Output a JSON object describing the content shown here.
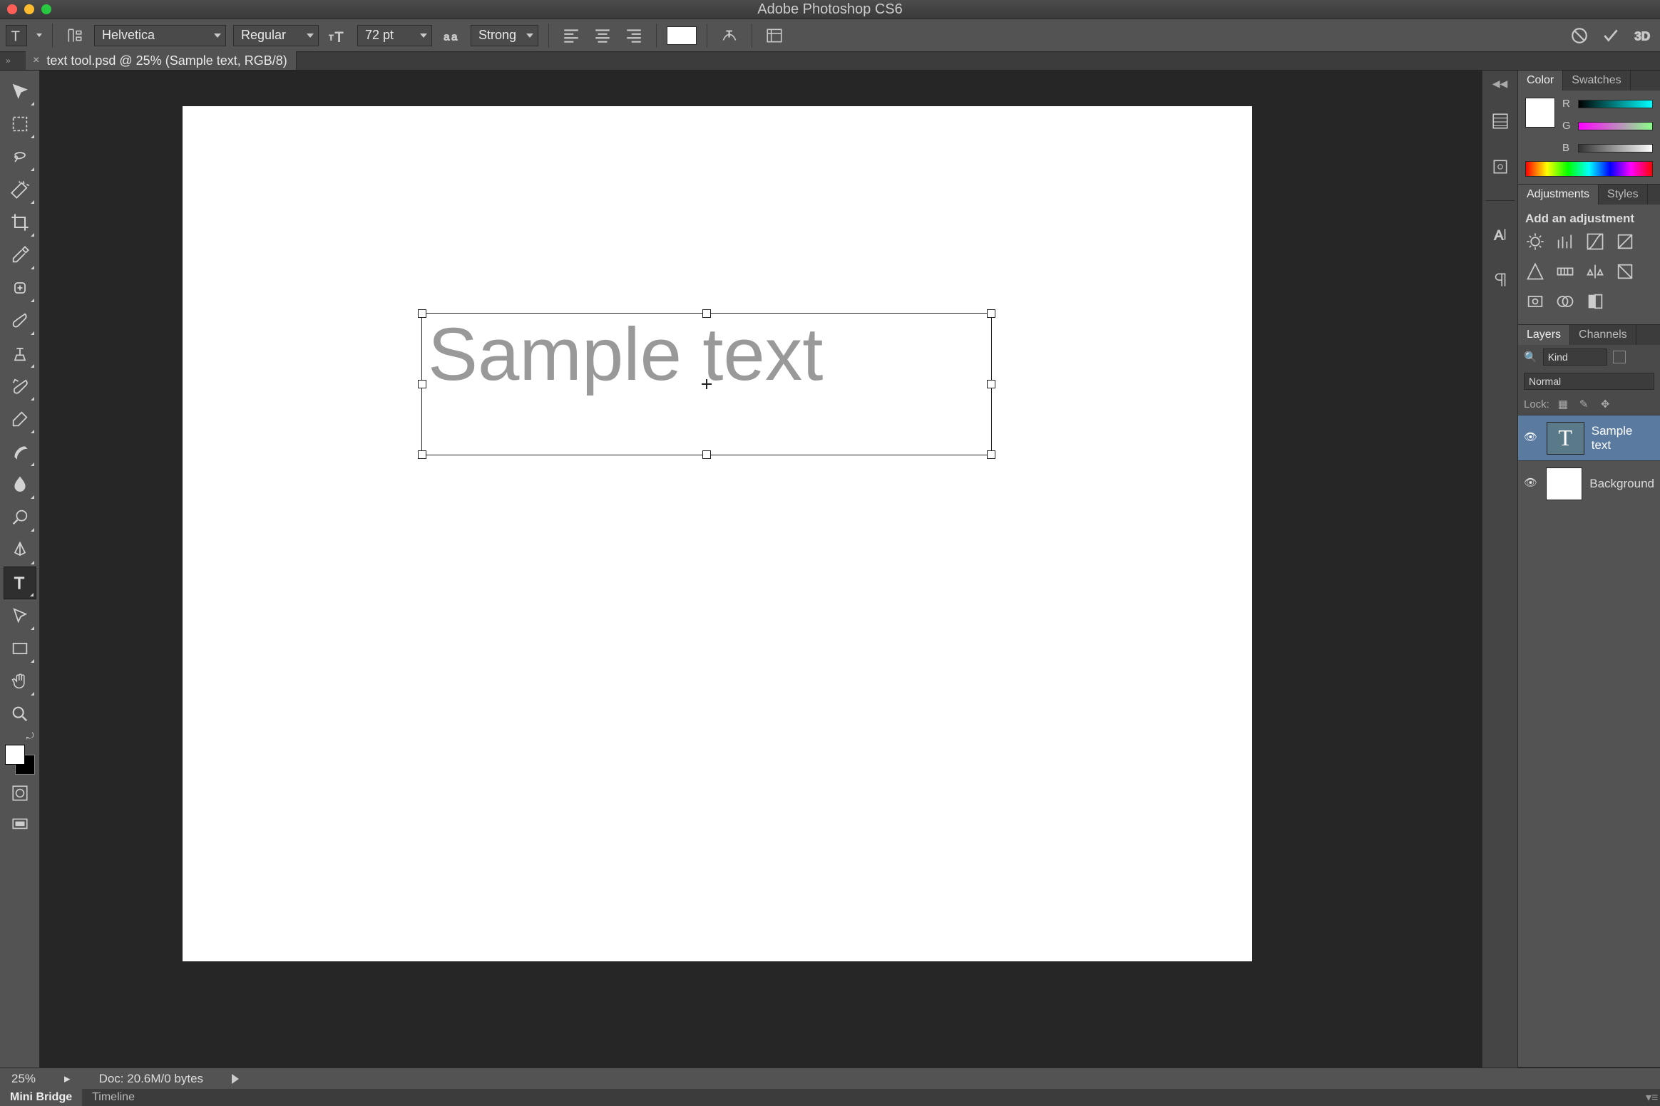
{
  "app": {
    "title": "Adobe Photoshop CS6"
  },
  "document": {
    "tab_label": "text tool.psd @ 25% (Sample text, RGB/8)",
    "zoom": "25%",
    "doc_size": "Doc: 20.6M/0 bytes"
  },
  "options": {
    "font_family": "Helvetica",
    "font_style": "Regular",
    "font_size": "72 pt",
    "anti_alias": "Strong",
    "text_color": "#ffffff"
  },
  "canvas": {
    "sample_text": "Sample text"
  },
  "panels": {
    "color": {
      "title": "Color",
      "swatches": "Swatches",
      "channels": [
        "R",
        "G",
        "B"
      ]
    },
    "adjustments": {
      "title": "Adjustments",
      "styles": "Styles",
      "hint": "Add an adjustment"
    },
    "layers": {
      "title": "Layers",
      "channels": "Channels",
      "filter": "Kind",
      "blend_mode": "Normal",
      "lock_label": "Lock:",
      "items": [
        {
          "name": "Sample text",
          "type": "text",
          "selected": true
        },
        {
          "name": "Background",
          "type": "raster",
          "selected": false
        }
      ]
    }
  },
  "bottom_tabs": {
    "mini_bridge": "Mini Bridge",
    "timeline": "Timeline"
  }
}
